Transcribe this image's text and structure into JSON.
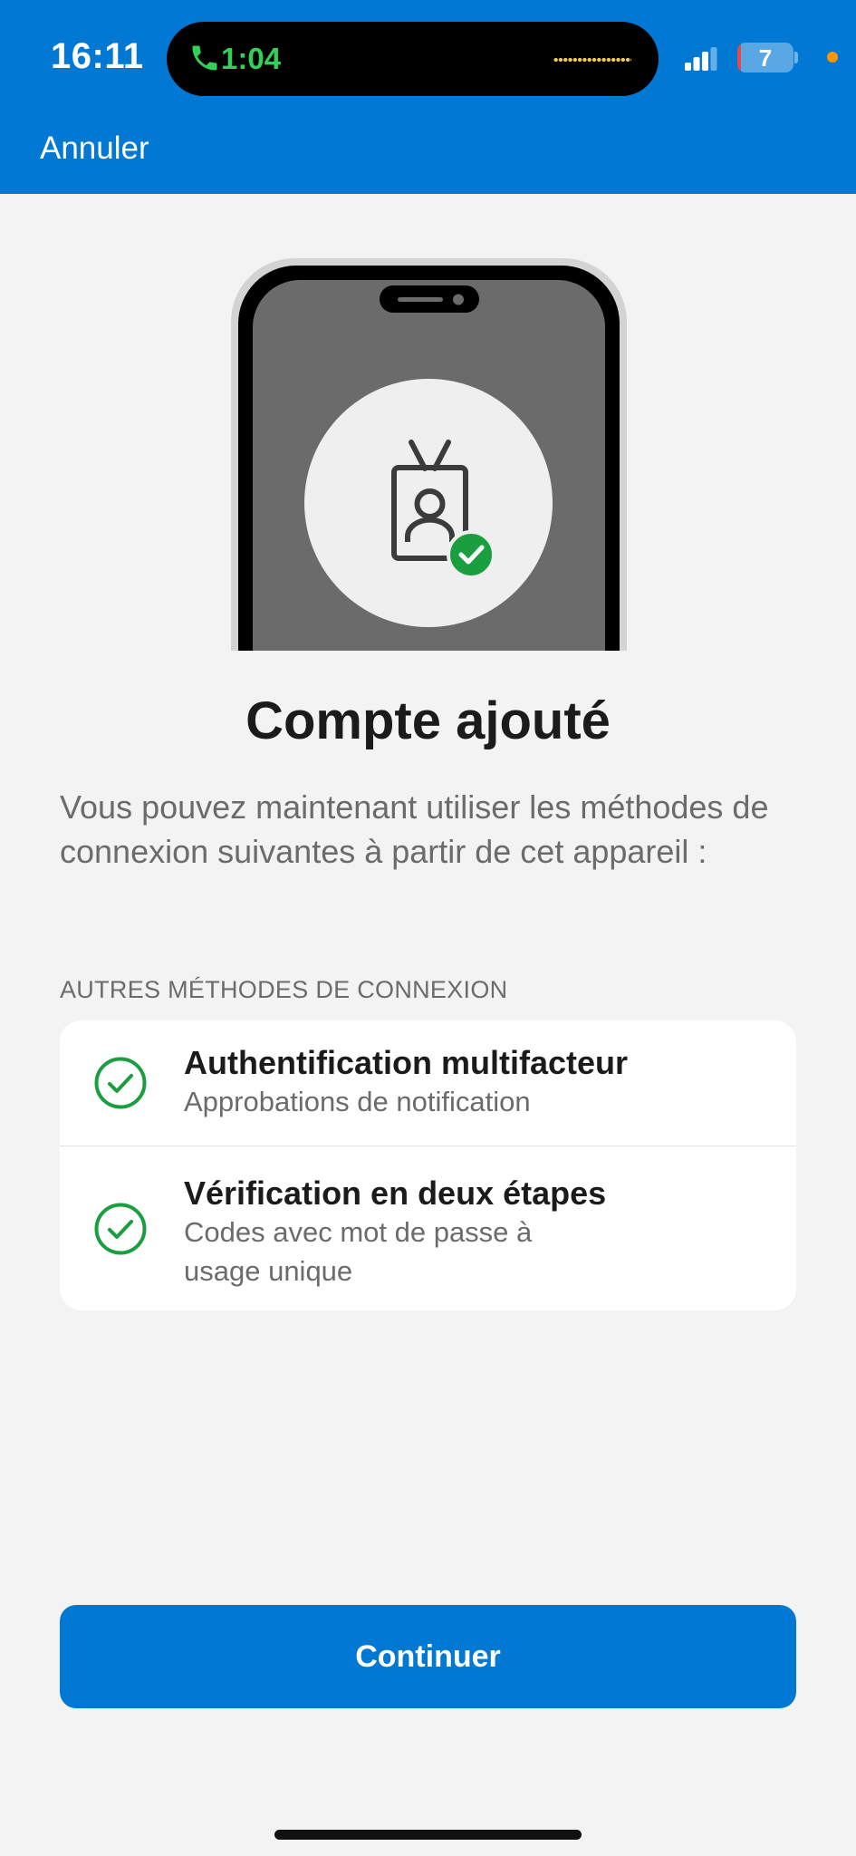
{
  "status_bar": {
    "time": "16:11",
    "call_timer": "1:04",
    "battery_level": "7",
    "battery_fraction": 0.07,
    "icons": [
      "phone-call-icon",
      "waveform-icon",
      "cellular-signal-icon",
      "battery-icon"
    ]
  },
  "nav": {
    "cancel_label": "Annuler"
  },
  "illustration": {
    "icons": [
      "phone-illustration",
      "id-badge-icon",
      "success-check-icon"
    ]
  },
  "page": {
    "title": "Compte ajouté",
    "description": "Vous pouvez maintenant utiliser les méthodes de connexion suivantes à partir de cet appareil :"
  },
  "methods": {
    "section_title": "AUTRES MÉTHODES DE CONNEXION",
    "items": [
      {
        "title": "Authentification multifacteur",
        "subtitle": "Approbations de notification",
        "icon": "check-circle-icon"
      },
      {
        "title": "Vérification en deux étapes",
        "subtitle": "Codes avec mot de passe à usage unique",
        "icon": "check-circle-icon"
      }
    ]
  },
  "footer": {
    "continue_label": "Continuer"
  },
  "colors": {
    "accent": "#0078d4",
    "success": "#1a9e3f",
    "background": "#f3f3f3",
    "title_text": "#1b1b1b",
    "secondary_text": "#6b6b6b"
  }
}
